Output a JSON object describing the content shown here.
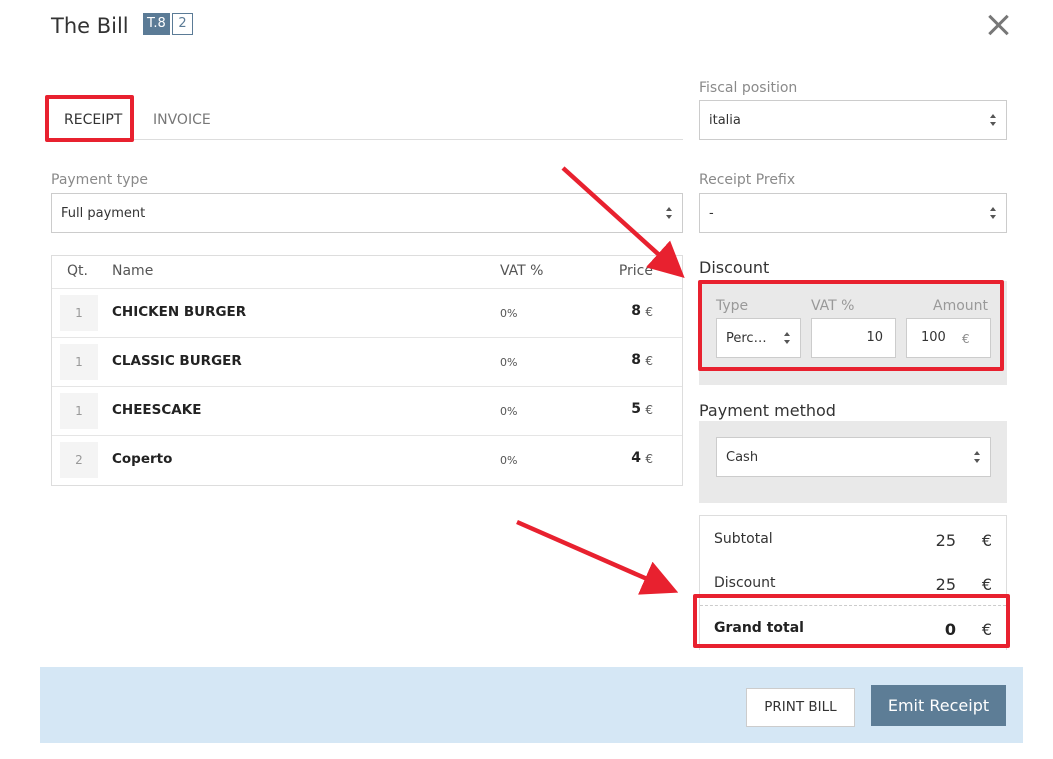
{
  "header": {
    "title": "The Bill",
    "table_badge": "T.8",
    "count_badge": "2"
  },
  "tabs": [
    {
      "label": "RECEIPT",
      "active": true
    },
    {
      "label": "INVOICE",
      "active": false
    }
  ],
  "payment_type": {
    "label": "Payment type",
    "value": "Full payment"
  },
  "fiscal_position": {
    "label": "Fiscal position",
    "value": "italia"
  },
  "receipt_prefix": {
    "label": "Receipt Prefix",
    "value": "-"
  },
  "items_table": {
    "headers": {
      "qty": "Qt.",
      "name": "Name",
      "vat": "VAT %",
      "price": "Price"
    },
    "rows": [
      {
        "qty": "1",
        "name": "CHICKEN BURGER",
        "vat": "0%",
        "price": "8",
        "currency": "€"
      },
      {
        "qty": "1",
        "name": "CLASSIC BURGER",
        "vat": "0%",
        "price": "8",
        "currency": "€"
      },
      {
        "qty": "1",
        "name": "CHEESCAKE",
        "vat": "0%",
        "price": "5",
        "currency": "€"
      },
      {
        "qty": "2",
        "name": "Coperto",
        "vat": "0%",
        "price": "4",
        "currency": "€"
      }
    ]
  },
  "discount": {
    "title": "Discount",
    "type_label": "Type",
    "vat_label": "VAT %",
    "amount_label": "Amount",
    "type_value": "Perc…",
    "vat_value": "10",
    "amount_value": "100",
    "amount_currency": "€"
  },
  "payment_method": {
    "title": "Payment method",
    "value": "Cash"
  },
  "totals": {
    "subtotal_label": "Subtotal",
    "subtotal_value": "25",
    "discount_label": "Discount",
    "discount_value": "25",
    "grand_total_label": "Grand total",
    "grand_total_value": "0",
    "currency": "€"
  },
  "footer": {
    "print_label": "PRINT BILL",
    "emit_label": "Emit Receipt"
  },
  "colors": {
    "highlight_red": "#e8212f",
    "accent_blue": "#5d7d96",
    "footer_bg": "#d5e7f5"
  },
  "icons": [
    "close-icon",
    "select-caret-icon",
    "annotation-arrow"
  ]
}
